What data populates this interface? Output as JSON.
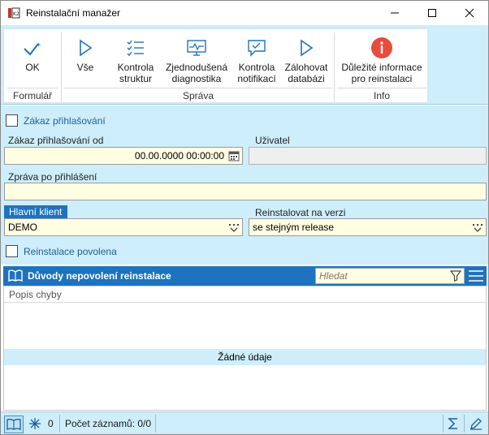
{
  "window": {
    "title": "Reinstalační manažer"
  },
  "ribbon": {
    "groups": {
      "formular": "Formulář",
      "sprava": "Správa",
      "info": "Info"
    },
    "buttons": {
      "ok": "OK",
      "vse": "Vše",
      "kontrola_struktur_1": "Kontrola",
      "kontrola_struktur_2": "struktur",
      "diag_1": "Zjednodušená",
      "diag_2": "diagnostika",
      "notif_1": "Kontrola",
      "notif_2": "notifikací",
      "zaloh_1": "Zálohovat",
      "zaloh_2": "databázi",
      "info_1": "Důležité informace",
      "info_2": "pro reinstalaci"
    },
    "colors": {
      "accent": "#1e73be",
      "info_icon": "#e84c3d"
    }
  },
  "form": {
    "zakaz_prihlasovani_label": "Zákaz přihlašování",
    "zakaz_od_label": "Zákaz přihlašování od",
    "zakaz_od_value": "00.00.0000 00:00:00",
    "uzivatel_label": "Uživatel",
    "uzivatel_value": "",
    "zprava_label": "Zpráva po přihlášení",
    "zprava_value": "",
    "hlavni_klient_label": "Hlavní klient",
    "hlavni_klient_value": "DEMO",
    "reinstalovat_label": "Reinstalovat na verzi",
    "reinstalovat_value": "se stejným release",
    "reinstalace_povolena_label": "Reinstalace povolena"
  },
  "grid": {
    "title": "Důvody nepovolení reinstalace",
    "search_placeholder": "Hledat",
    "column": "Popis chyby",
    "no_data": "Žádné údaje"
  },
  "status": {
    "snowflake_count": "0",
    "record_count": "Počet záznamů: 0/0"
  }
}
